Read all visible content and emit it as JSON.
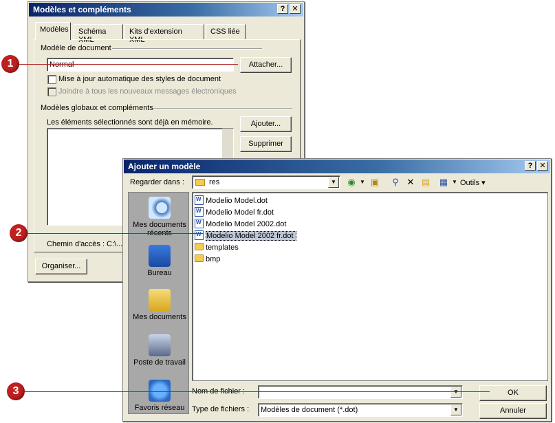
{
  "dialog1": {
    "title": "Modèles et compléments",
    "help_btn": "?",
    "close_btn": "✕",
    "tabs": [
      {
        "label": "Modèles"
      },
      {
        "label": "Schéma XML"
      },
      {
        "label": "Kits d'extension XML"
      },
      {
        "label": "CSS liée"
      }
    ],
    "template_section": "Modèle de document",
    "template_value": "Normal",
    "attach_label": "Attacher...",
    "auto_update_label": "Mise à jour automatique des styles de document",
    "attach_email_label": "Joindre à tous les nouveaux messages électroniques",
    "global_section": "Modèles globaux et compléments",
    "loaded_note": "Les éléments sélectionnés sont déjà en mémoire.",
    "add_label": "Ajouter...",
    "remove_label": "Supprimer",
    "path_label": "Chemin d'accès :",
    "path_value": "C:\\...",
    "organize_label": "Organiser..."
  },
  "dialog2": {
    "title": "Ajouter un modèle",
    "help_btn": "?",
    "close_btn": "✕",
    "look_in_label": "Regarder dans :",
    "look_in_value": "res",
    "tools_label": "Outils",
    "places": [
      {
        "label": "Mes documents récents"
      },
      {
        "label": "Bureau"
      },
      {
        "label": "Mes documents"
      },
      {
        "label": "Poste de travail"
      },
      {
        "label": "Favoris réseau"
      }
    ],
    "files": [
      {
        "name": "Modelio Model.dot"
      },
      {
        "name": "Modelio Model fr.dot"
      },
      {
        "name": "Modelio Model 2002.dot"
      },
      {
        "name": "Modelio Model 2002 fr.dot"
      },
      {
        "name": "templates"
      },
      {
        "name": "bmp"
      }
    ],
    "filename_label": "Nom de fichier :",
    "filename_value": "",
    "filetype_label": "Type de fichiers :",
    "filetype_value": "Modèles de document (*.dot)",
    "ok_label": "OK",
    "cancel_label": "Annuler"
  },
  "callouts": [
    "1",
    "2",
    "3"
  ],
  "colors": {
    "callout": "#c02020",
    "titlebar": "#0a246a"
  }
}
